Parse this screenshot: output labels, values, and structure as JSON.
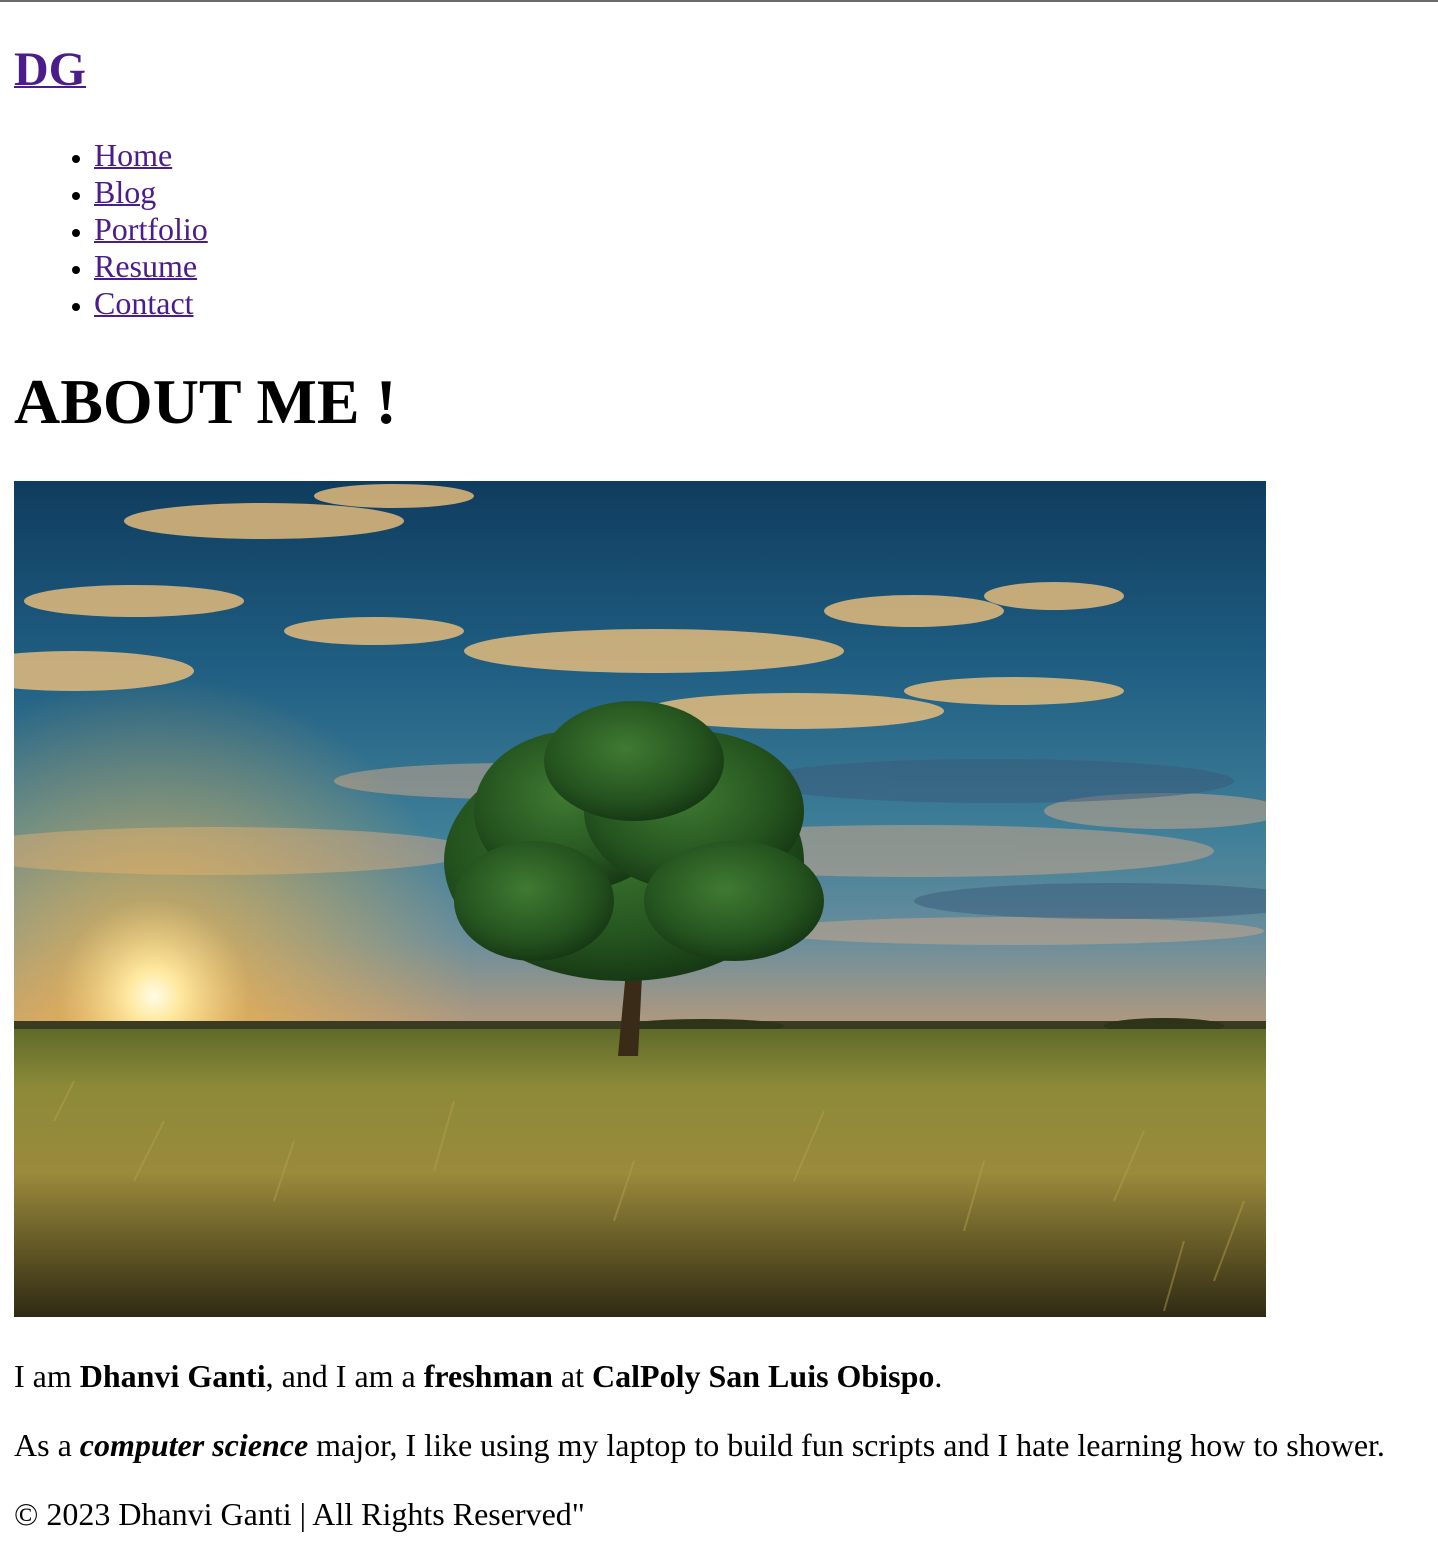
{
  "header": {
    "logo_text": "DG"
  },
  "nav": {
    "items": [
      {
        "label": "Home"
      },
      {
        "label": "Blog"
      },
      {
        "label": "Portfolio"
      },
      {
        "label": "Resume"
      },
      {
        "label": "Contact"
      }
    ]
  },
  "main": {
    "title": "ABOUT ME !",
    "hero_image": {
      "description_icon": "landscape-photo"
    },
    "intro": {
      "t1": "I am ",
      "name": "Dhanvi Ganti",
      "t2": ", and I am a ",
      "year": "freshman",
      "t3": " at ",
      "school": "CalPoly San Luis Obispo",
      "t4": "."
    },
    "major": {
      "t1": "As a ",
      "major": "computer science",
      "t2": " major, I like using my laptop to build fun scripts and I hate learning how to shower."
    }
  },
  "footer": {
    "text": "© 2023 Dhanvi Ganti | All Rights Reserved\""
  },
  "colors": {
    "link": "#4b1c8c",
    "text": "#000000",
    "background": "#ffffff"
  }
}
